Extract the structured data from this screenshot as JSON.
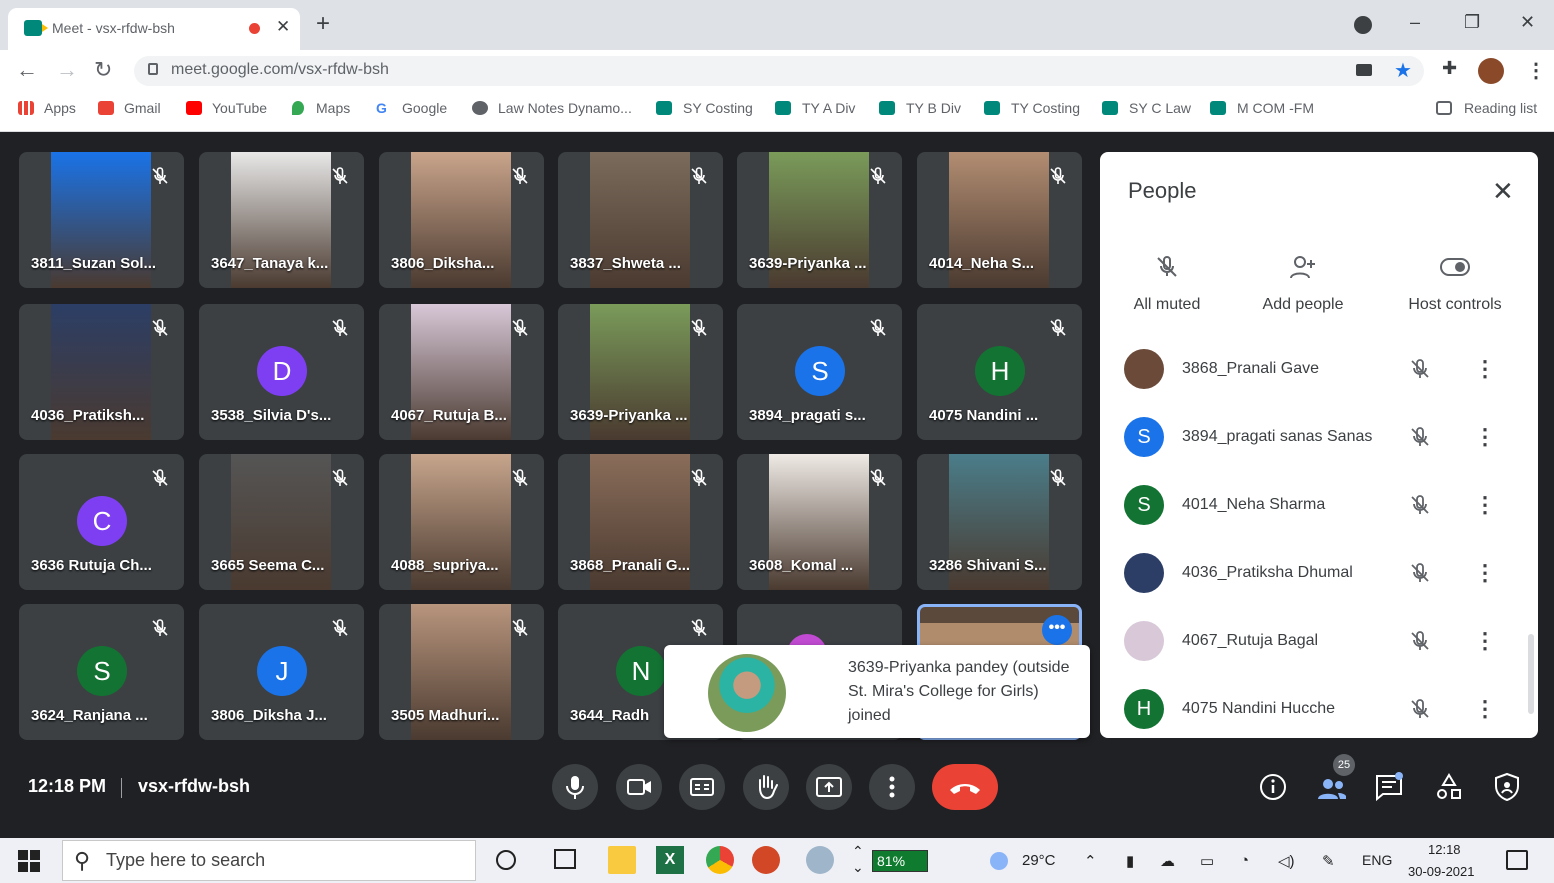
{
  "browser": {
    "tab_title": "Meet - vsx-rfdw-bsh",
    "url": "meet.google.com/vsx-rfdw-bsh",
    "bookmarks": [
      "Apps",
      "Gmail",
      "YouTube",
      "Maps",
      "Google",
      "Law Notes Dynamo...",
      "SY Costing",
      "TY A Div",
      "TY B Div",
      "TY Costing",
      "SY C Law",
      "M COM -FM"
    ],
    "reading_list": "Reading list"
  },
  "tiles": [
    {
      "name": "3811_Suzan Sol...",
      "initial": "",
      "color": "#1a73e8"
    },
    {
      "name": "3647_Tanaya k...",
      "initial": "",
      "color": "#e8e8e8"
    },
    {
      "name": "3806_Diksha...",
      "initial": "",
      "color": "#c9a48b"
    },
    {
      "name": "3837_Shweta ...",
      "initial": "",
      "color": "#7b6b5c"
    },
    {
      "name": "3639-Priyanka ...",
      "initial": "",
      "color": "#7a9b5a"
    },
    {
      "name": "4014_Neha S...",
      "initial": "",
      "color": "#b28d72"
    },
    {
      "name": "4036_Pratiksh...",
      "initial": "",
      "color": "#2c3e66"
    },
    {
      "name": "3538_Silvia D's...",
      "initial": "D",
      "color": "#7e3ff2"
    },
    {
      "name": "4067_Rutuja B...",
      "initial": "",
      "color": "#d8c8d8"
    },
    {
      "name": "3639-Priyanka ...",
      "initial": "",
      "color": "#7a9b5a"
    },
    {
      "name": "3894_pragati s...",
      "initial": "S",
      "color": "#1a73e8"
    },
    {
      "name": "4075 Nandini ...",
      "initial": "H",
      "color": "#137333"
    },
    {
      "name": "3636 Rutuja Ch...",
      "initial": "C",
      "color": "#7e3ff2"
    },
    {
      "name": "3665 Seema C...",
      "initial": "",
      "color": "#555"
    },
    {
      "name": "4088_supriya...",
      "initial": "",
      "color": "#c7a58c"
    },
    {
      "name": "3868_Pranali G...",
      "initial": "",
      "color": "#8a6d5a"
    },
    {
      "name": "3608_Komal ...",
      "initial": "",
      "color": "#efeae5"
    },
    {
      "name": "3286 Shivani S...",
      "initial": "",
      "color": "#4a7d8a"
    },
    {
      "name": "3624_Ranjana ...",
      "initial": "S",
      "color": "#137333"
    },
    {
      "name": "3806_Diksha J...",
      "initial": "J",
      "color": "#1a73e8"
    },
    {
      "name": "3505 Madhuri...",
      "initial": "",
      "color": "#b8957d"
    },
    {
      "name": "3644_Radh",
      "initial": "N",
      "color": "#137333"
    }
  ],
  "toast": {
    "text": "3639-Priyanka pandey (outside St. Mira's College for Girls) joined"
  },
  "people": {
    "title": "People",
    "actions": [
      "All muted",
      "Add people",
      "Host controls"
    ],
    "list": [
      {
        "name": "3868_Pranali Gave",
        "initial": "",
        "color": "#6b4a3a"
      },
      {
        "name": "3894_pragati sanas Sanas",
        "initial": "S",
        "color": "#1a73e8"
      },
      {
        "name": "4014_Neha Sharma",
        "initial": "S",
        "color": "#137333"
      },
      {
        "name": "4036_Pratiksha Dhumal",
        "initial": "",
        "color": "#2c3e66"
      },
      {
        "name": "4067_Rutuja Bagal",
        "initial": "",
        "color": "#d8c8d8"
      },
      {
        "name": "4075 Nandini Hucche",
        "initial": "H",
        "color": "#137333"
      }
    ]
  },
  "meeting": {
    "time": "12:18 PM",
    "code": "vsx-rfdw-bsh",
    "people_count": "25"
  },
  "taskbar": {
    "search_placeholder": "Type here to search",
    "battery": "81%",
    "temperature": "29°C",
    "lang": "ENG",
    "clock_time": "12:18",
    "clock_date": "30-09-2021"
  }
}
